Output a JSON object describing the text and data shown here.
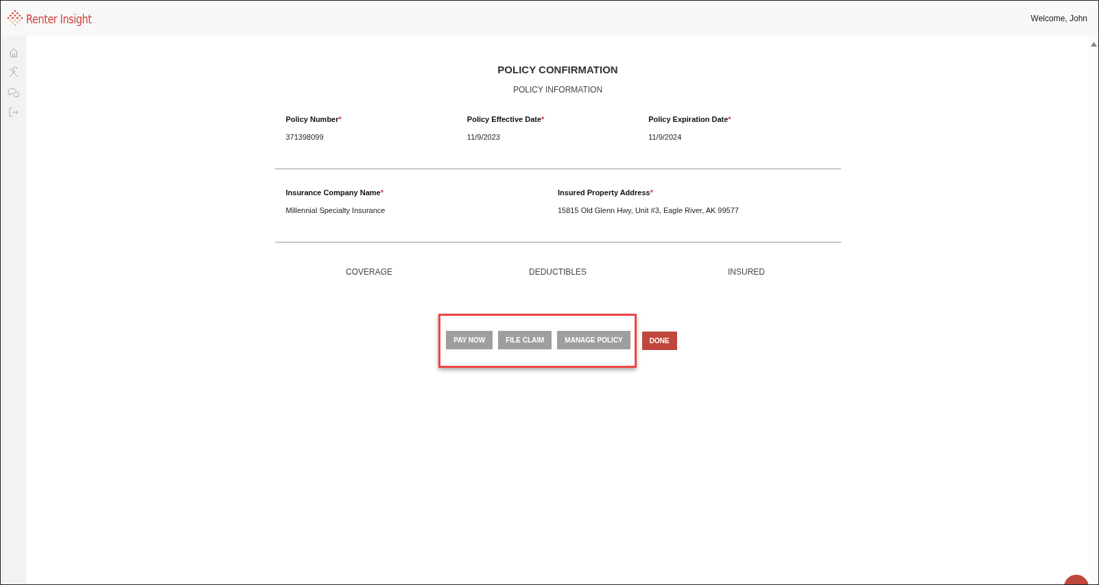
{
  "header": {
    "brand": "Renter Insight",
    "welcome": "Welcome, John"
  },
  "title": "POLICY CONFIRMATION",
  "subtitle": "POLICY INFORMATION",
  "sections": [
    {
      "fields": [
        {
          "label": "Policy Number",
          "mark": "*",
          "value": "371398099"
        },
        {
          "label": "Policy Effective Date",
          "mark": "*",
          "value": "11/9/2023"
        },
        {
          "label": "Policy Expiration Date",
          "mark": "*",
          "value": "11/9/2024"
        }
      ]
    },
    {
      "fields": [
        {
          "label": "Insurance Company Name",
          "mark": "*",
          "value": "Millennial Specialty Insurance"
        },
        {
          "label": "Insured Property Address",
          "mark": "*",
          "value": "15815 Old Glenn Hwy, Unit #3, Eagle River, AK 99577"
        }
      ]
    }
  ],
  "tabs": [
    "COVERAGE",
    "DEDUCTIBLES",
    "INSURED"
  ],
  "highlighted_buttons": [
    {
      "label": "PAY NOW",
      "disabled": true
    },
    {
      "label": "FILE CLAIM",
      "disabled": true
    },
    {
      "label": "MANAGE POLICY",
      "disabled": true
    }
  ],
  "buttons": [
    {
      "label": "DONE",
      "disabled": false
    }
  ]
}
